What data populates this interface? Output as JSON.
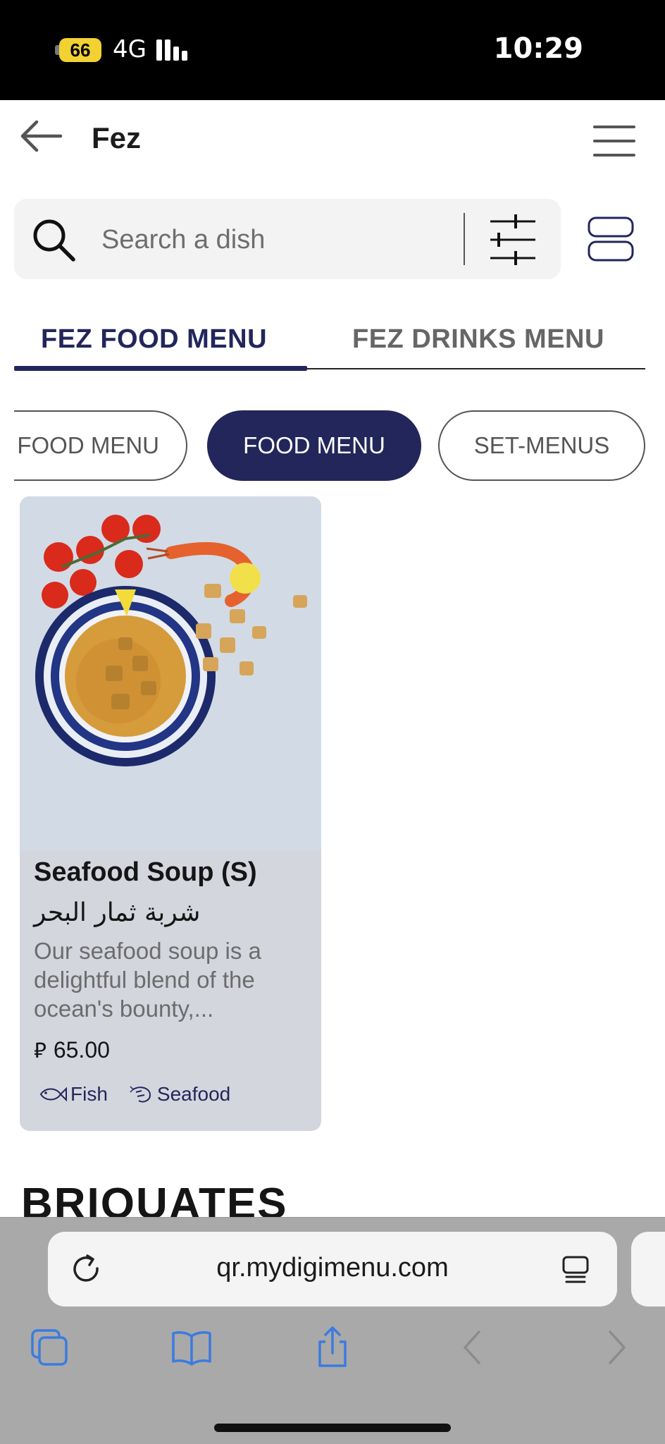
{
  "status_bar": {
    "battery": "66",
    "network": "4G",
    "time": "10:29"
  },
  "header": {
    "title": "Fez"
  },
  "search": {
    "placeholder": "Search a dish"
  },
  "menu_tabs": [
    {
      "label": "FEZ FOOD MENU",
      "active": true
    },
    {
      "label": "FEZ DRINKS MENU",
      "active": false
    }
  ],
  "category_chips": [
    {
      "label": "FOOD MENU",
      "active": false
    },
    {
      "label": "FOOD MENU",
      "active": true
    },
    {
      "label": "SET-MENUS",
      "active": false
    }
  ],
  "dish": {
    "name": "Seafood Soup (S)",
    "name_ar": "شربة ثمار البحر",
    "description": "Our seafood soup is a delightful blend of the ocean's bounty,...",
    "price": "65.00",
    "currency_icon": "saudi-riyal-symbol",
    "tags": [
      {
        "label": "Fish",
        "icon": "fish-icon"
      },
      {
        "label": "Seafood",
        "icon": "shrimp-icon"
      }
    ]
  },
  "section": {
    "title": "BRIQUATES"
  },
  "browser": {
    "url": "qr.mydigimenu.com"
  },
  "colors": {
    "accent": "#23265a",
    "card_bg": "#d4d6de",
    "browser_chrome": "#a9a9a9",
    "toolbar_icon": "#3b7be0"
  }
}
